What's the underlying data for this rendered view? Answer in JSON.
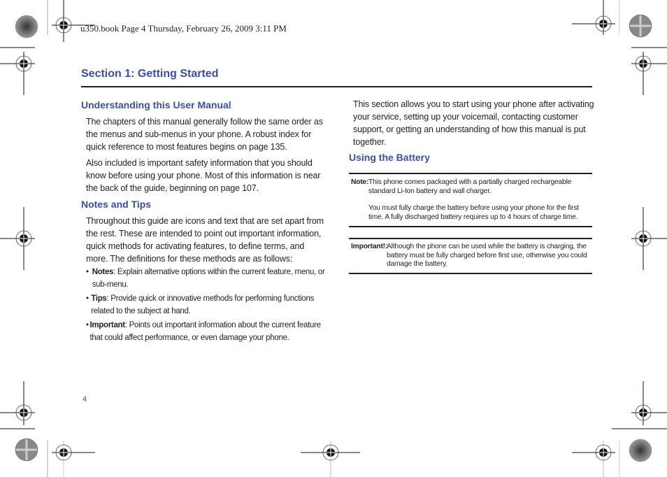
{
  "header": {
    "slug_line": "u350.book  Page 4  Thursday, February 26, 2009  3:11 PM"
  },
  "section": {
    "title": "Section 1: Getting Started"
  },
  "left_column": {
    "understanding": {
      "heading": "Understanding this User Manual",
      "paragraphs": [
        "The chapters of this manual generally follow the same order as the menus and sub-menus in your phone. A robust index for quick reference to most features begins on page 135.",
        "Also included is important safety information that you should know before using your phone. Most of this information is near the back of the guide, beginning on page 107."
      ]
    },
    "notes_tips": {
      "heading": "Notes and Tips",
      "intro": "Throughout this guide are icons and text that are set apart from the rest. These are intended to point out important information, quick methods for activating features, to define terms, and more. The definitions for these methods are as follows:",
      "bullets": [
        {
          "term": "Notes",
          "text": ": Explain alternative options within the current feature, menu, or sub-menu."
        },
        {
          "term": "Tips",
          "text": ": Provide quick or innovative methods for performing functions related to the subject at hand."
        },
        {
          "term": "Important",
          "text": ": Points out important information about the current feature that could affect performance, or even damage your phone."
        }
      ],
      "bullet_glyph": "•"
    }
  },
  "right_column": {
    "intro": "This section allows you to start using your phone after activating your service, setting up your voicemail, contacting customer support, or getting an understanding of how this manual is put together.",
    "battery": {
      "heading": "Using the Battery",
      "note": {
        "label": "Note:",
        "line1": "This phone comes packaged with a partially charged rechargeable standard Li-Ion battery and wall charger.",
        "line2": "You must fully charge the battery before using your phone for the first time. A fully discharged battery requires up to 4 hours of charge time."
      },
      "important": {
        "label": "Important!:",
        "text": "Although the phone can be used while the battery is charging, the battery must be fully charged before first use, otherwise you could damage the battery."
      }
    }
  },
  "footer": {
    "page_number": "4"
  }
}
